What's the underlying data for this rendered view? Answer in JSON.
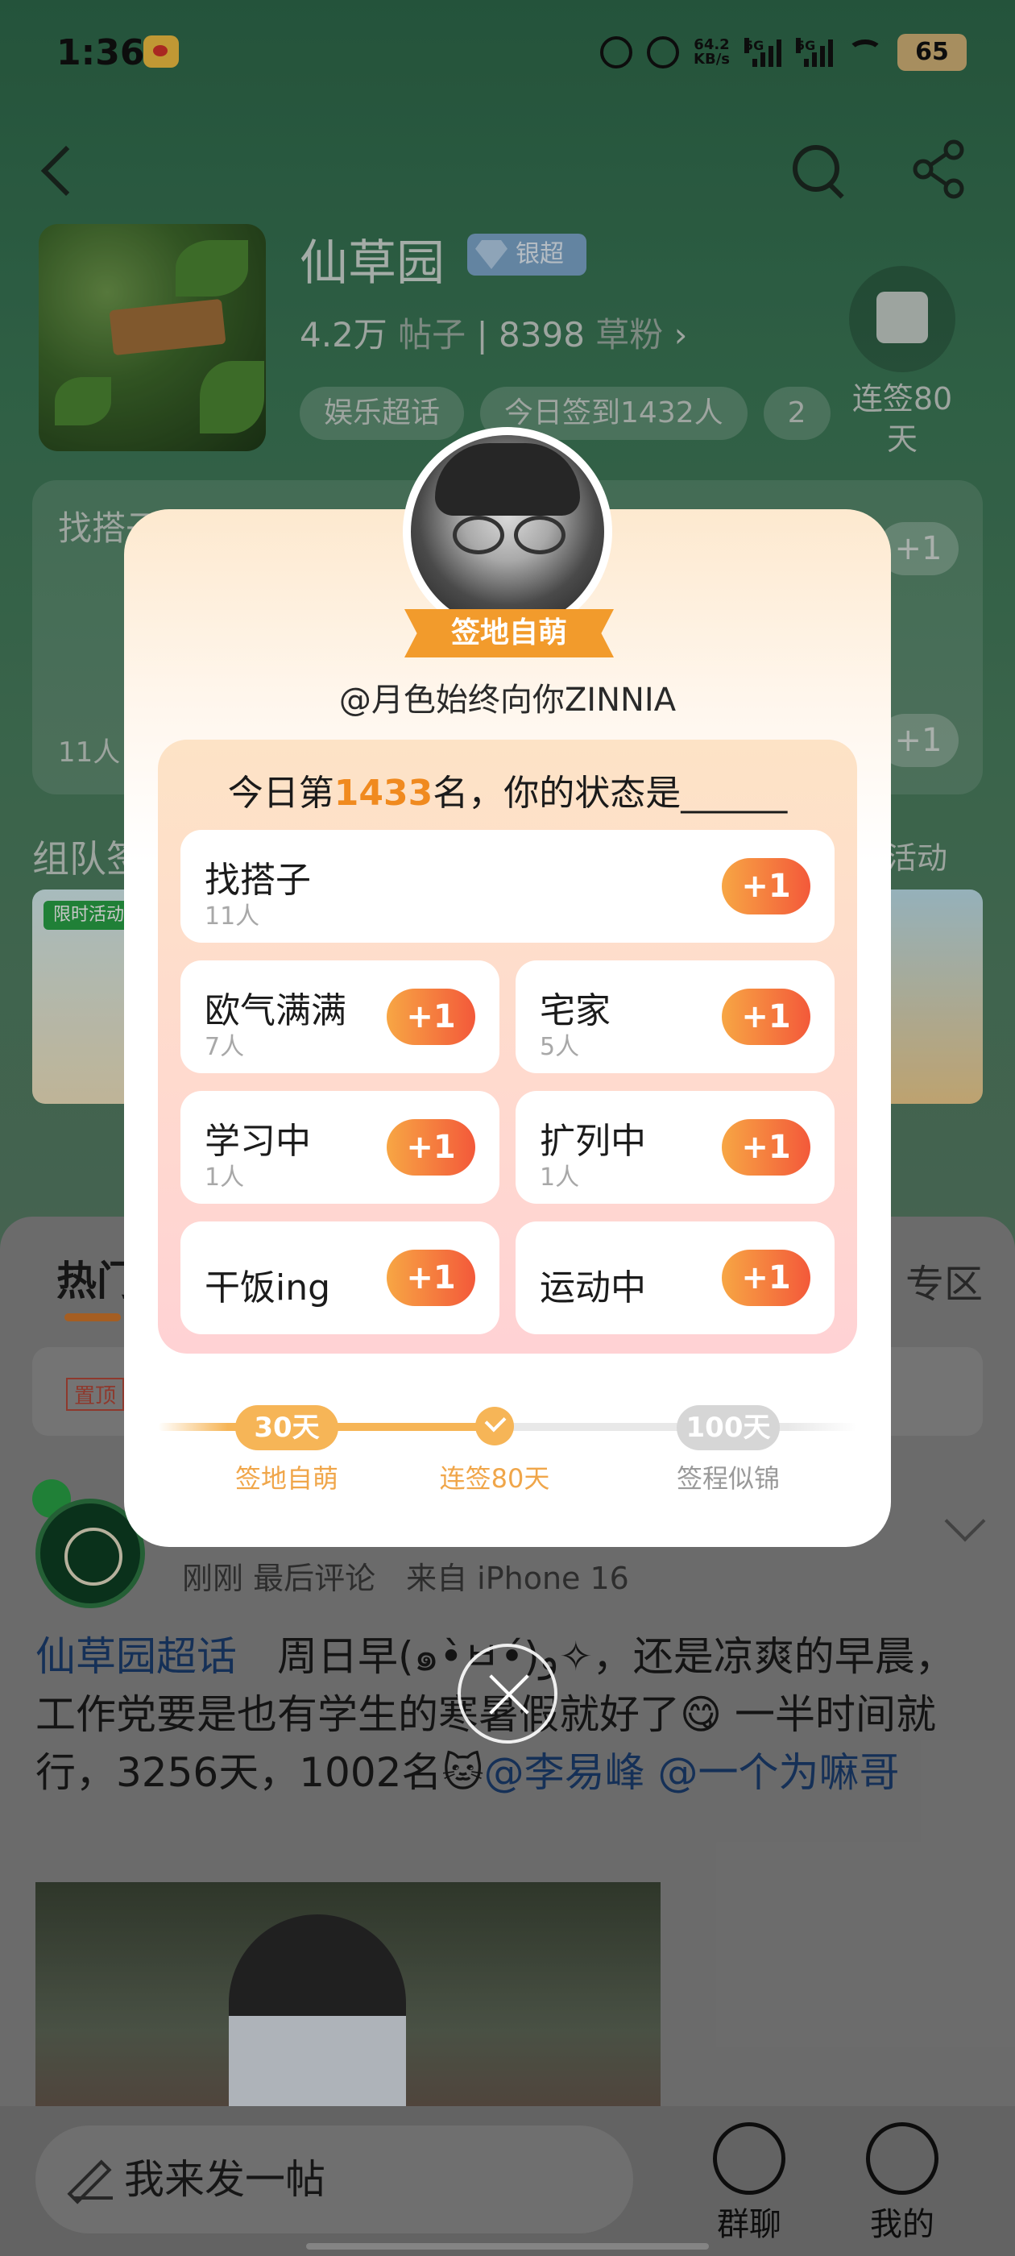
{
  "status_bar": {
    "time": "1:36",
    "net_speed": "64.2",
    "net_unit": "KB/s",
    "sig1": "5G",
    "sig2": "5G",
    "battery": "65"
  },
  "topic": {
    "name": "仙草园",
    "badge": "银超",
    "posts": "4.2万",
    "posts_label": "帖子",
    "fans": "8398",
    "fans_label": "草粉",
    "tags": [
      "娱乐超话",
      "今日签到1432人",
      "2"
    ],
    "checkin_label": "连签80天"
  },
  "cards": {
    "c1": "找搭子",
    "count": "11人",
    "plus": "+1"
  },
  "team": {
    "title": "组队签",
    "activity": "活动"
  },
  "banner": {
    "limited": "限时活动"
  },
  "feed": {
    "tab": "热门",
    "right_tab": "专区",
    "pinned": "置顶",
    "meta": "刚刚 最后评论　来自 iPhone 16",
    "text_link1": "仙草园超话",
    "text_body": "　周日早(๑•̀ㅂ•́)و✧，还是凉爽的早晨，工作党要是也有学生的寒暑假就好了😋 一半时间就行，3256天，1002名🐱",
    "text_link2": "@李易峰 @一个为嘛哥"
  },
  "bottom_bar": {
    "compose": "我来发一帖",
    "group_chat": "群聊",
    "mine": "我的"
  },
  "modal": {
    "ribbon": "签地自萌",
    "username": "@月色始终向你ZINNIA",
    "title_prefix": "今日第",
    "rank": "1433",
    "title_suffix": "名，你的状态是______",
    "plus_label": "+1",
    "options": [
      {
        "name": "找搭子",
        "count": "11人"
      },
      {
        "name": "欧气满满",
        "count": "7人"
      },
      {
        "name": "宅家",
        "count": "5人"
      },
      {
        "name": "学习中",
        "count": "1人"
      },
      {
        "name": "扩列中",
        "count": "1人"
      },
      {
        "name": "干饭ing",
        "count": ""
      },
      {
        "name": "运动中",
        "count": ""
      }
    ],
    "milestones": [
      {
        "pill": "30天",
        "label": "签地自萌",
        "reached": true
      },
      {
        "pill": "",
        "label": "连签80天",
        "reached": true
      },
      {
        "pill": "100天",
        "label": "签程似锦",
        "reached": false
      }
    ]
  }
}
